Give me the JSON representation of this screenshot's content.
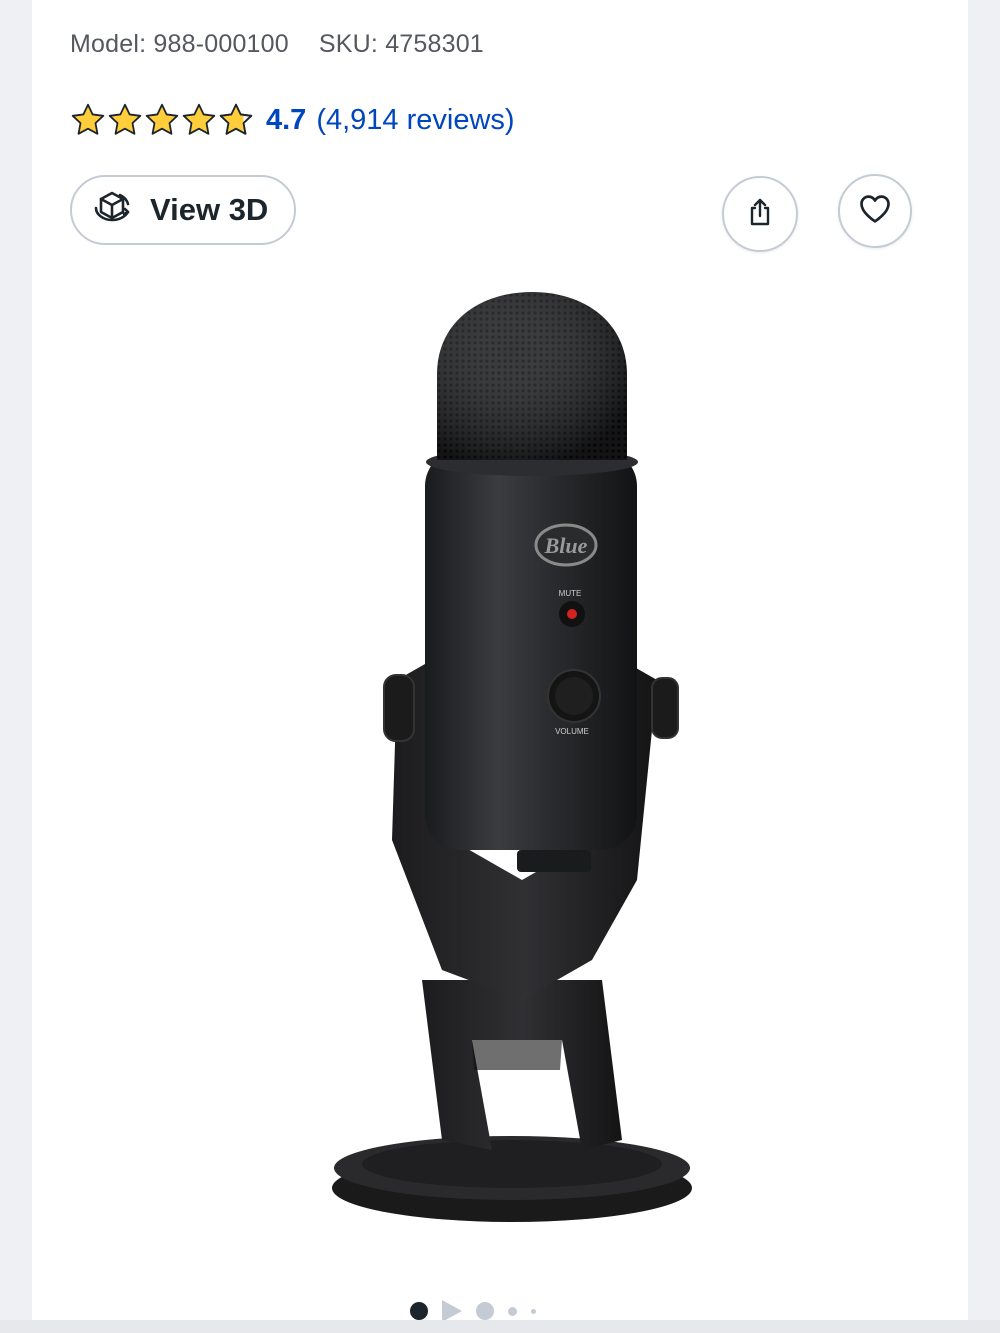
{
  "product": {
    "model_label": "Model:",
    "model_value": "988-000100",
    "sku_label": "SKU:",
    "sku_value": "4758301"
  },
  "rating": {
    "stars": 4.7,
    "value": "4.7",
    "count_text": "(4,914 reviews)"
  },
  "actions": {
    "view3d_label": "View 3D",
    "share_icon": "share-icon",
    "favorite_icon": "heart-icon"
  },
  "image": {
    "logo_text": "Blue",
    "mute_label": "MUTE",
    "volume_label": "VOLUME"
  },
  "carousel": {
    "slides": 5,
    "active_index": 0
  },
  "colors": {
    "accent": "#0046be",
    "star": "#ffce3a",
    "text": "#1d252c"
  }
}
